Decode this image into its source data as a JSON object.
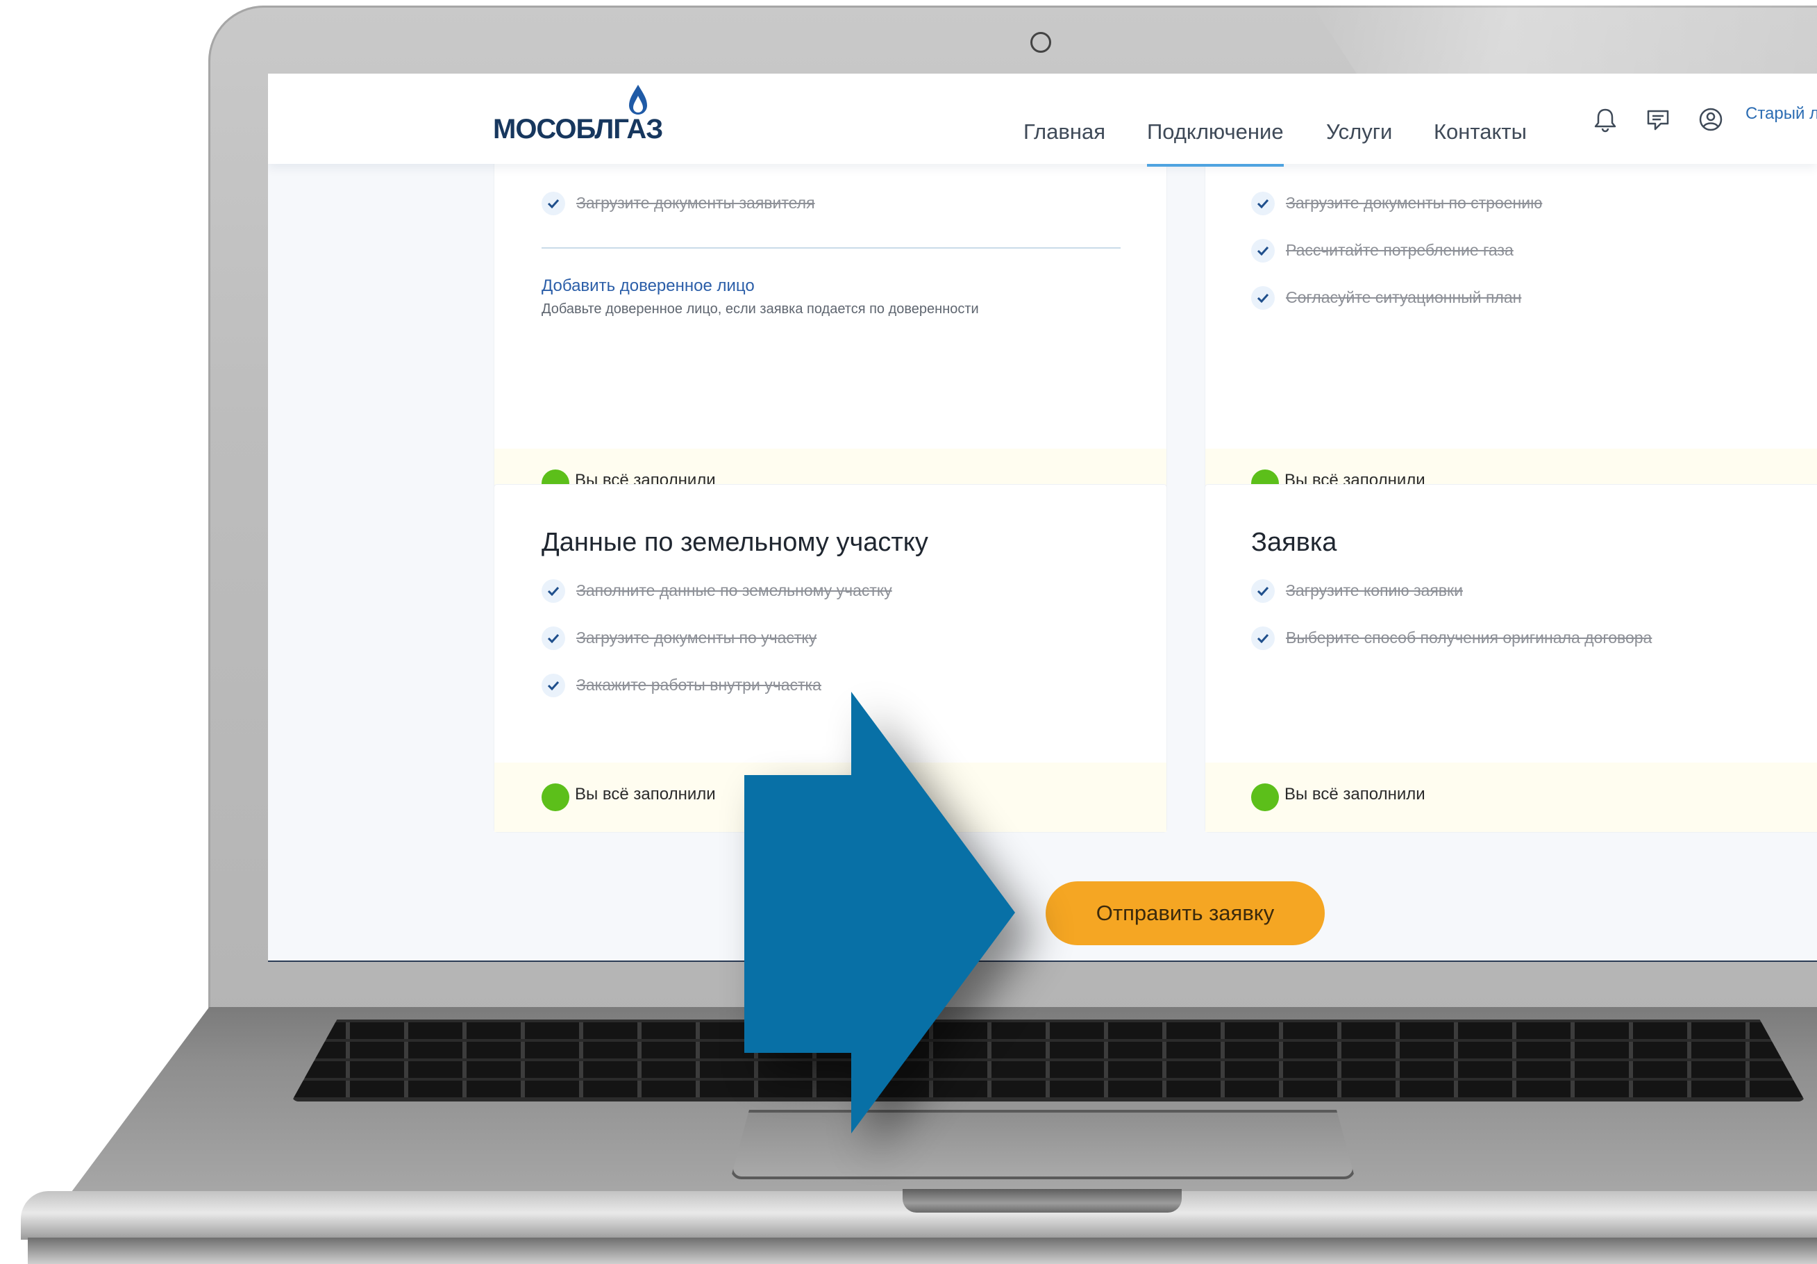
{
  "header": {
    "logo": "МОСОБЛГАЗ",
    "nav": [
      "Главная",
      "Подключение",
      "Услуги",
      "Контакты"
    ],
    "active_nav": "Подключение",
    "old_link": "Старый л"
  },
  "cards": {
    "top_left": {
      "task": "Загрузите документы заявителя",
      "proxy_link": "Добавить доверенное лицо",
      "proxy_hint": "Добавьте доверенное лицо, если заявка подается по доверенности",
      "status": "Вы всё заполнили"
    },
    "top_right": {
      "tasks": [
        "Загрузите документы по строению",
        "Рассчитайте потребление газа",
        "Согласуйте ситуационный план"
      ],
      "status": "Вы всё заполнили"
    },
    "land": {
      "title": "Данные по земельному участку",
      "tasks": [
        "Заполните данные по земельному участку",
        "Загрузите документы по участку",
        "Закажите работы внутри участка"
      ],
      "status": "Вы всё заполнили"
    },
    "application": {
      "title": "Заявка",
      "tasks": [
        "Загрузите копию заявки",
        "Выберите способ получения оригинала договора"
      ],
      "status": "Вы всё заполнили"
    }
  },
  "submit_label": "Отправить заявку",
  "colors": {
    "accent_orange": "#f5a623",
    "arrow_blue": "#0870a6",
    "done_green": "#5cbf1a",
    "logo_navy": "#17375e"
  }
}
